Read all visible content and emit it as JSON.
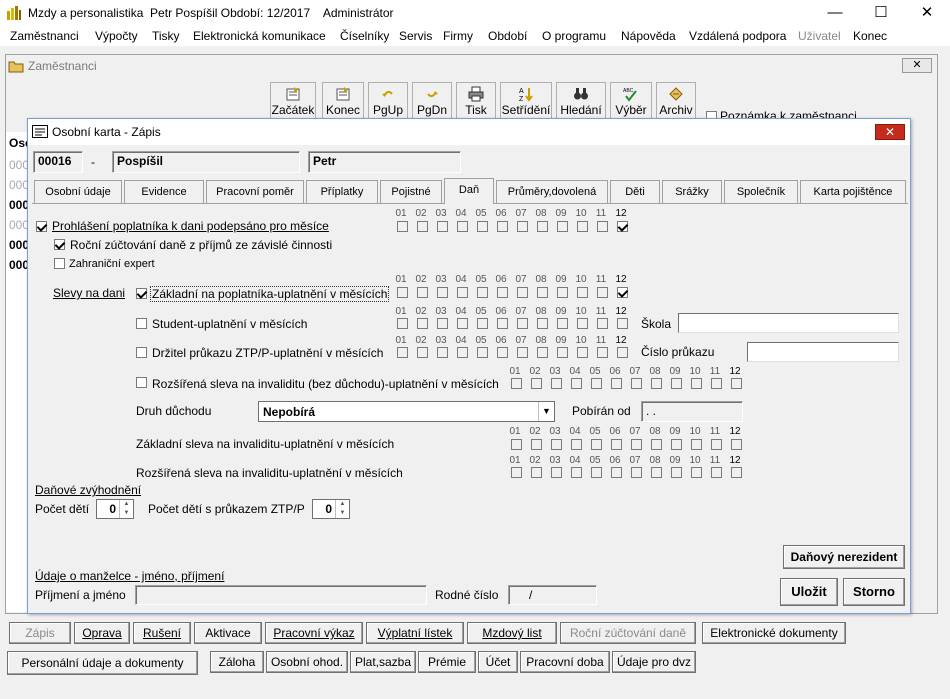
{
  "app": {
    "title": "Mzdy a personalistika  Petr Pospíšil Období: 12/2017    Administrátor"
  },
  "window_controls": {
    "minimize": "—",
    "maximize": "☐",
    "close": "✕"
  },
  "menu": [
    "Zaměstnanci",
    "Výpočty",
    "Tisky",
    "Elektronická komunikace",
    "Číselníky",
    "Servis",
    "Firmy",
    "Období",
    "O programu",
    "Nápověda",
    "Vzdálená podpora",
    "Uživatel",
    "Konec"
  ],
  "mdi": {
    "title": "Zaměstnanci"
  },
  "toolbar": [
    "Začátek",
    "Konec",
    "PgUp",
    "PgDn",
    "Tisk",
    "Setřídění",
    "Hledání",
    "Výběr",
    "Archiv"
  ],
  "note_checkbox": "Poznámka k zaměstnanci",
  "list": {
    "header": "Osc",
    "rows": [
      "000",
      "000",
      "000",
      "000",
      "000",
      "000"
    ]
  },
  "dialog": {
    "title": "Osobní karta - Zápis",
    "emp_number": "00016",
    "dash": "-",
    "surname": "Pospíšil",
    "firstname": "Petr",
    "tabs": [
      "Osobní údaje",
      "Evidence",
      "Pracovní poměr",
      "Příplatky",
      "Pojistné",
      "Daň",
      "Průměry,dovolená",
      "Děti",
      "Srážky",
      "Společník",
      "Karta pojištěnce"
    ],
    "months": [
      "01",
      "02",
      "03",
      "04",
      "05",
      "06",
      "07",
      "08",
      "09",
      "10",
      "11",
      "12"
    ],
    "prohlaseni": "Prohlášení poplatníka k dani podepsáno pro měsíce",
    "rocni": "Roční zúčtování daně z příjmů ze závislé činnosti",
    "zahranicni": "Zahraniční expert",
    "slevy_label": "Slevy na dani",
    "zakladni": "Základní na poplatníka-uplatnění v měsících",
    "student": "Student-uplatnění v měsících",
    "skola_label": "Škola",
    "ztp": "Držitel průkazu ZTP/P-uplatnění v měsících",
    "cislo_prukazu_label": "Číslo průkazu",
    "rozsirena_bez": "Rozšířená sleva na invaliditu (bez důchodu)-uplatnění v měsících",
    "druh_duchodu_label": "Druh důchodu",
    "druh_duchodu_value": "Nepobírá",
    "pobiran_od_label": "Pobírán od",
    "pobiran_od_value": ". .",
    "zakl_invalid": "Základní sleva na invaliditu-uplatnění v měsících",
    "rozs_invalid": "Rozšířená sleva na invaliditu-uplatnění v měsících",
    "danove_zvyh": "Daňové zvýhodnění",
    "pocet_deti_label": "Počet dětí",
    "pocet_deti_value": "0",
    "pocet_ztp_label": "Počet dětí s průkazem ZTP/P",
    "pocet_ztp_value": "0",
    "nerezident": "Daňový nerezident",
    "manzelka_label": "Údaje o manželce - jméno, příjmení",
    "prijmeni_jmeno_label": "Příjmení a jméno",
    "rodne_cislo_label": "Rodné číslo",
    "rodne_cislo_value": "/",
    "ulozit": "Uložit",
    "storno": "Storno"
  },
  "bottom_row1": [
    "Zápis",
    "Oprava",
    "Rušení",
    "Aktivace",
    "Pracovní výkaz",
    "Výplatní lístek",
    "Mzdový list",
    "Roční zúčtování daně",
    "Elektronické dokumenty"
  ],
  "bottom_row2": [
    "Personální údaje a dokumenty",
    "Záloha",
    "Osobní ohod.",
    "Plat,sazba",
    "Prémie",
    "Účet",
    "Pracovní doba",
    "Údaje pro dvz"
  ]
}
